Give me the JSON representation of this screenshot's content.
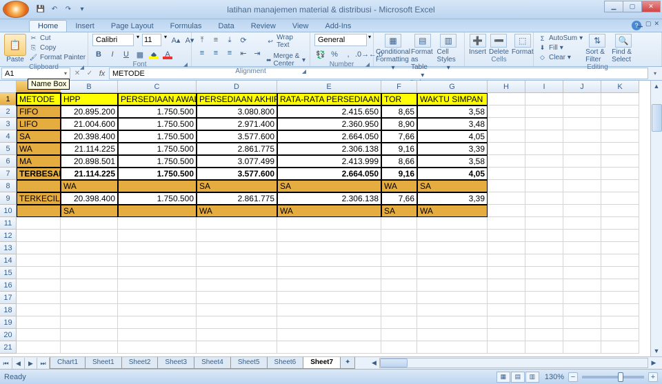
{
  "title": "latihan manajemen material & distribusi - Microsoft Excel",
  "qat": {
    "save": "💾",
    "undo": "↶",
    "redo": "↷"
  },
  "tabs": [
    "Home",
    "Insert",
    "Page Layout",
    "Formulas",
    "Data",
    "Review",
    "View",
    "Add-Ins"
  ],
  "active_tab": "Home",
  "tooltip_namebox": "Name Box",
  "ribbon": {
    "clipboard": {
      "label": "Clipboard",
      "paste": "Paste",
      "cut": "Cut",
      "copy": "Copy",
      "fp": "Format Painter"
    },
    "font": {
      "label": "Font",
      "name": "Calibri",
      "size": "11"
    },
    "alignment": {
      "label": "Alignment",
      "wrap": "Wrap Text",
      "merge": "Merge & Center"
    },
    "number": {
      "label": "Number",
      "format": "General"
    },
    "styles": {
      "label": "Styles",
      "cf": "Conditional Formatting",
      "tbl": "Format as Table",
      "cell": "Cell Styles"
    },
    "cells": {
      "label": "Cells",
      "insert": "Insert",
      "delete": "Delete",
      "format": "Format"
    },
    "editing": {
      "label": "Editing",
      "autosum": "AutoSum",
      "fill": "Fill",
      "clear": "Clear",
      "sort": "Sort & Filter",
      "find": "Find & Select"
    }
  },
  "name_box": "A1",
  "formula": "METODE",
  "cols": [
    {
      "l": "A",
      "w": 64
    },
    {
      "l": "B",
      "w": 83
    },
    {
      "l": "C",
      "w": 114
    },
    {
      "l": "D",
      "w": 117
    },
    {
      "l": "E",
      "w": 151
    },
    {
      "l": "F",
      "w": 52
    },
    {
      "l": "G",
      "w": 102
    },
    {
      "l": "H",
      "w": 55
    },
    {
      "l": "I",
      "w": 55
    },
    {
      "l": "J",
      "w": 55
    },
    {
      "l": "K",
      "w": 55
    }
  ],
  "rows_visible": 21,
  "headers": [
    "METODE",
    "HPP",
    "PERSEDIAAN AWAL",
    "PERSEDIAAN AKHIR",
    "RATA-RATA PERSEDIAAN",
    "TOR",
    "WAKTU SIMPAN"
  ],
  "data_rows": [
    [
      "FIFO",
      "20.895.200",
      "1.750.500",
      "3.080.800",
      "2.415.650",
      "8,65",
      "3,58"
    ],
    [
      "LIFO",
      "21.004.600",
      "1.750.500",
      "2.971.400",
      "2.360.950",
      "8,90",
      "3,48"
    ],
    [
      "SA",
      "20.398.400",
      "1.750.500",
      "3.577.600",
      "2.664.050",
      "7,66",
      "4,05"
    ],
    [
      "WA",
      "21.114.225",
      "1.750.500",
      "2.861.775",
      "2.306.138",
      "9,16",
      "3,39"
    ],
    [
      "MA",
      "20.898.501",
      "1.750.500",
      "3.077.499",
      "2.413.999",
      "8,66",
      "3,58"
    ]
  ],
  "row_terbesar_label": "TERBESAR",
  "row_terbesar": [
    "21.114.225",
    "1.750.500",
    "3.577.600",
    "2.664.050",
    "9,16",
    "4,05"
  ],
  "row_terbesar_names": [
    "",
    "WA",
    "",
    "SA",
    "SA",
    "WA",
    "SA"
  ],
  "row_terkecil_label": "TERKECIL",
  "row_terkecil": [
    "20.398.400",
    "1.750.500",
    "2.861.775",
    "2.306.138",
    "7,66",
    "3,39"
  ],
  "row_terkecil_names": [
    "",
    "SA",
    "",
    "WA",
    "WA",
    "SA",
    "WA"
  ],
  "sheet_tabs": [
    "Chart1",
    "Sheet1",
    "Sheet2",
    "Sheet3",
    "Sheet4",
    "Sheet5",
    "Sheet6",
    "Sheet7"
  ],
  "active_sheet": "Sheet7",
  "status": "Ready",
  "zoom": "130%"
}
